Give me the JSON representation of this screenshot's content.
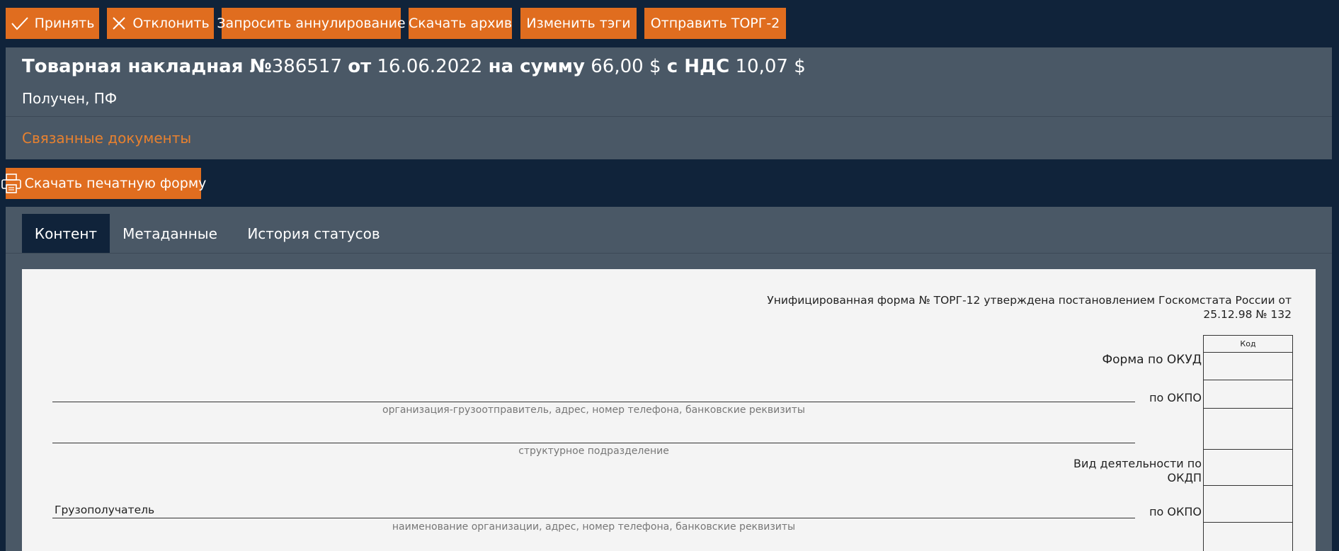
{
  "toolbar": {
    "accept": "Принять",
    "reject": "Отклонить",
    "request_cancel": "Запросить аннулирование",
    "download_archive": "Скачать архив",
    "change_tags": "Изменить тэги",
    "send_torg2": "Отправить ТОРГ-2"
  },
  "header": {
    "title_prefix": "Товарная накладная №",
    "number": "386517",
    "from_label": "от",
    "date": "16.06.2022",
    "sum_label": "на сумму",
    "sum": "66,00 $",
    "vat_label": "с НДС",
    "vat": "10,07 $",
    "status": "Получен, ПФ",
    "related_docs": "Связанные документы"
  },
  "print_button": "Скачать печатную форму",
  "tabs": [
    {
      "label": "Контент",
      "active": true
    },
    {
      "label": "Метаданные",
      "active": false
    },
    {
      "label": "История статусов",
      "active": false
    }
  ],
  "document": {
    "form_note_line1": "Унифицированная форма № ТОРГ-12 утверждена постановлением Госкомстата России от",
    "form_note_line2": "25.12.98 № 132",
    "code_header": "Код",
    "okud_label": "Форма по ОКУД",
    "okpo_label": "по ОКПО",
    "shipper_caption": "организация-грузоотправитель, адрес, номер телефона, банковские реквизиты",
    "subdivision_caption": "структурное подразделение",
    "okdp_label_line1": "Вид деятельности по",
    "okdp_label_line2": "ОКДП",
    "consignee_label": "Грузополучатель",
    "okpo_label2": "по ОКПО",
    "consignee_caption": "наименование организации, адрес, номер телефона, банковские реквизиты"
  },
  "colors": {
    "background": "#10233a",
    "panel": "#4a5866",
    "accent": "#e06d1f",
    "link": "#e8812f",
    "sheet": "#f4f4f4"
  },
  "icons": {
    "accept": "checkmark-icon",
    "reject": "close-icon",
    "print": "printer-icon"
  }
}
